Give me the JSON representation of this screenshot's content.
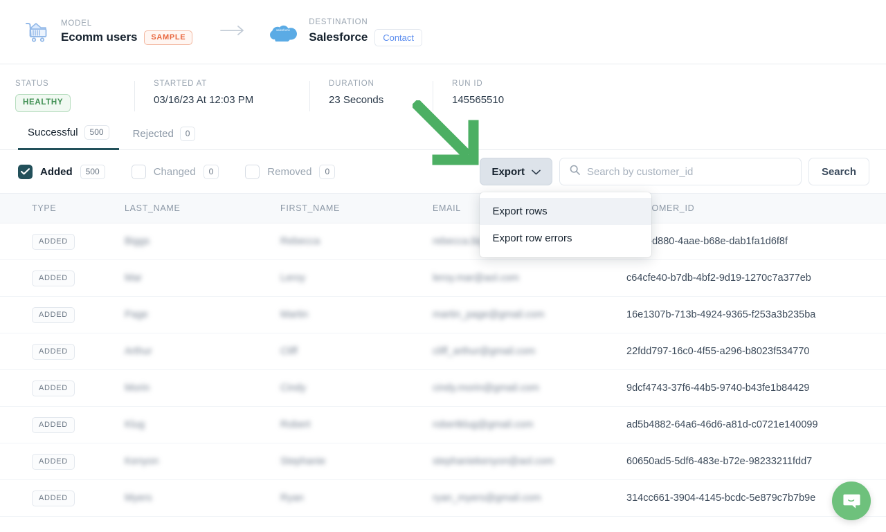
{
  "header": {
    "model": {
      "label": "MODEL",
      "name": "Ecomm users",
      "badge": "SAMPLE",
      "icon": "shopping-cart-icon"
    },
    "destination": {
      "label": "DESTINATION",
      "name": "Salesforce",
      "badge": "Contact",
      "icon": "salesforce-cloud-icon"
    },
    "separator_icon": "arrow-right-icon"
  },
  "meta": {
    "status": {
      "label": "STATUS",
      "value": "HEALTHY"
    },
    "started_at": {
      "label": "STARTED AT",
      "value": "03/16/23 At 12:03 PM"
    },
    "duration": {
      "label": "DURATION",
      "value": "23 Seconds"
    },
    "run_id": {
      "label": "RUN ID",
      "value": "145565510"
    }
  },
  "tabs": [
    {
      "label": "Successful",
      "count": "500",
      "active": true
    },
    {
      "label": "Rejected",
      "count": "0",
      "active": false
    }
  ],
  "filters": [
    {
      "label": "Added",
      "count": "500",
      "checked": true
    },
    {
      "label": "Changed",
      "count": "0",
      "checked": false
    },
    {
      "label": "Removed",
      "count": "0",
      "checked": false
    }
  ],
  "toolbar": {
    "export_label": "Export",
    "export_chevron_icon": "chevron-down-icon",
    "search_placeholder": "Search by customer_id",
    "search_value": "",
    "search_icon": "search-icon",
    "search_button_label": "Search"
  },
  "export_menu": {
    "open": true,
    "items": [
      {
        "label": "Export rows",
        "hovered": true
      },
      {
        "label": "Export row errors",
        "hovered": false
      }
    ]
  },
  "table": {
    "columns": [
      "TYPE",
      "LAST_NAME",
      "FIRST_NAME",
      "EMAIL",
      "CUSTOMER_ID"
    ],
    "rows": [
      {
        "type": "ADDED",
        "last_name": "Biggs",
        "first_name": "Rebecca",
        "email": "rebecca.biggs@gmail.com",
        "customer_id": "4308-d880-4aae-b68e-dab1fa1d6f8f"
      },
      {
        "type": "ADDED",
        "last_name": "Mar",
        "first_name": "Leroy",
        "email": "leroy.mar@aol.com",
        "customer_id": "c64cfe40-b7db-4bf2-9d19-1270c7a377eb"
      },
      {
        "type": "ADDED",
        "last_name": "Page",
        "first_name": "Martin",
        "email": "martin_page@gmail.com",
        "customer_id": "16e1307b-713b-4924-9365-f253a3b235ba"
      },
      {
        "type": "ADDED",
        "last_name": "Arthur",
        "first_name": "Cliff",
        "email": "cliff_arthur@gmail.com",
        "customer_id": "22fdd797-16c0-4f55-a296-b8023f534770"
      },
      {
        "type": "ADDED",
        "last_name": "Morin",
        "first_name": "Cindy",
        "email": "cindy.morin@gmail.com",
        "customer_id": "9dcf4743-37f6-44b5-9740-b43fe1b84429"
      },
      {
        "type": "ADDED",
        "last_name": "Klug",
        "first_name": "Robert",
        "email": "robertklug@gmail.com",
        "customer_id": "ad5b4882-64a6-46d6-a81d-c0721e140099"
      },
      {
        "type": "ADDED",
        "last_name": "Kenyon",
        "first_name": "Stephanie",
        "email": "stephaniekenyon@aol.com",
        "customer_id": "60650ad5-5df6-483e-b72e-98233211fdd7"
      },
      {
        "type": "ADDED",
        "last_name": "Myers",
        "first_name": "Ryan",
        "email": "ryan_myers@gmail.com",
        "customer_id": "314cc661-3904-4145-bcdc-5e879c7b7b9e"
      }
    ]
  },
  "annotation": {
    "icon": "green-arrow-down-right",
    "color": "#4caf63"
  },
  "support": {
    "icon": "intercom-chat-icon",
    "color": "#6ec17c"
  },
  "colors": {
    "accent": "#22505a",
    "healthy": "#3f8f52",
    "sample": "#e8663d",
    "contact": "#5b8def"
  }
}
